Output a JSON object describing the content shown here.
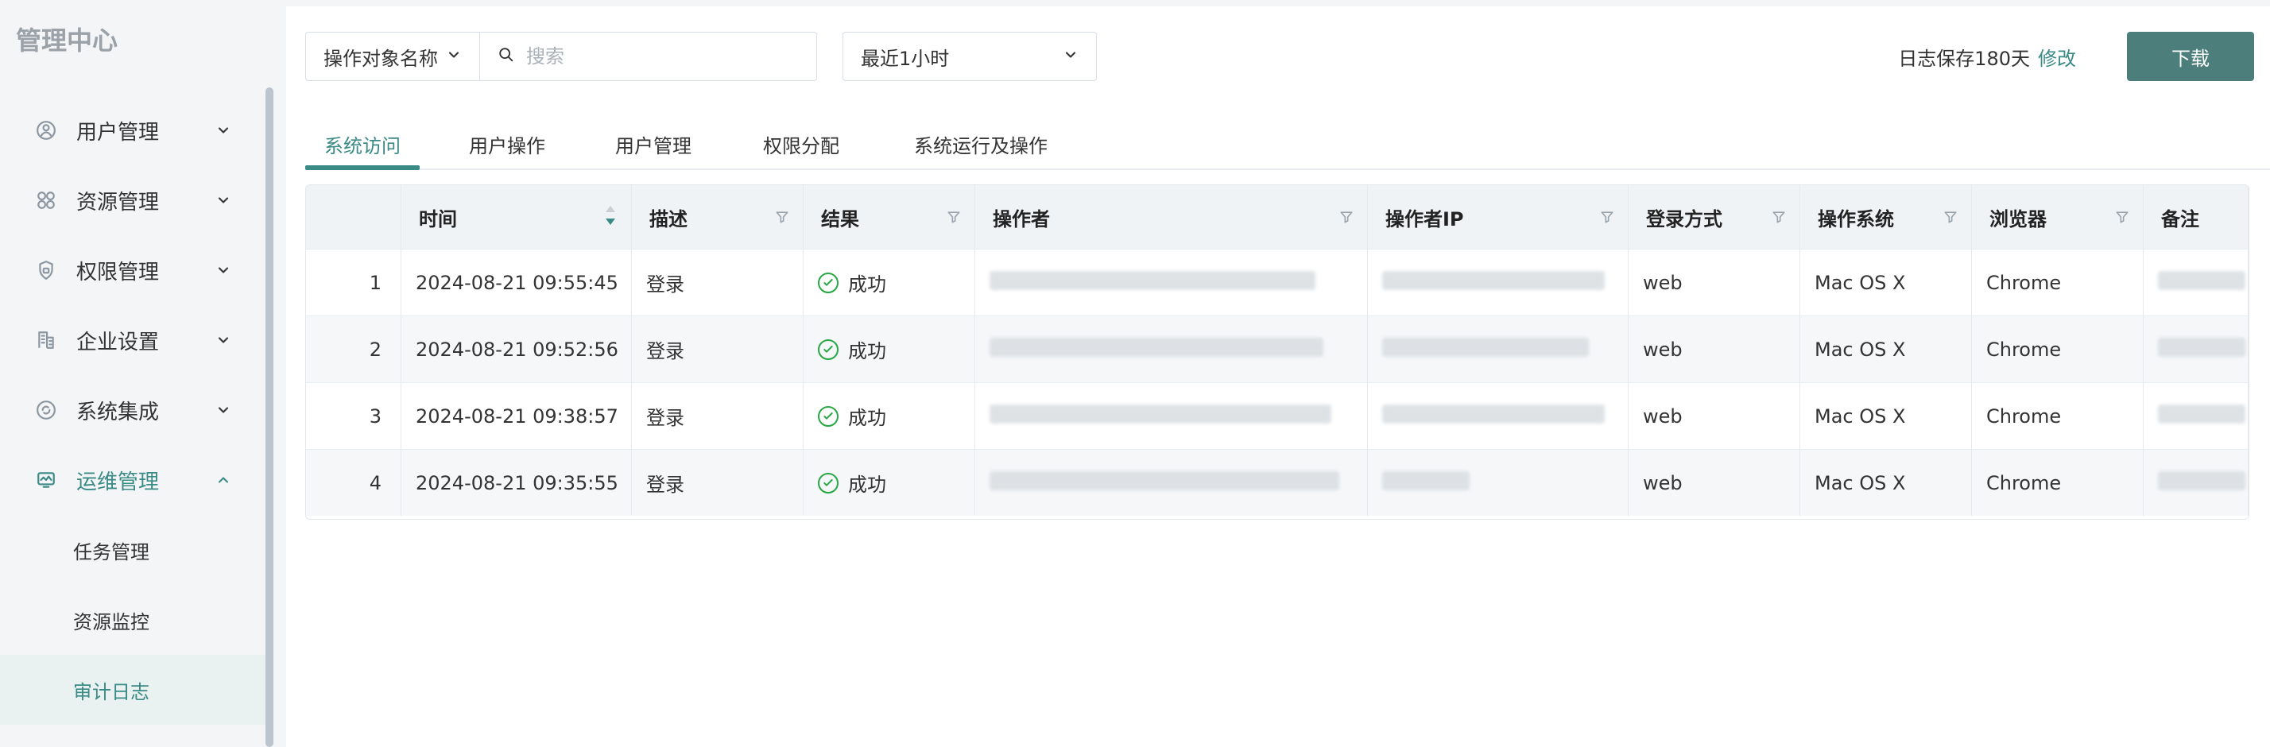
{
  "app": {
    "title": "管理中心"
  },
  "colors": {
    "accent": "#3a8a86",
    "button": "#4c7f7b",
    "success": "#28a745"
  },
  "sidebar": {
    "items": [
      {
        "label": "用户管理",
        "icon": "user-icon",
        "expanded": false
      },
      {
        "label": "资源管理",
        "icon": "grid-icon",
        "expanded": false
      },
      {
        "label": "权限管理",
        "icon": "shield-icon",
        "expanded": false
      },
      {
        "label": "企业设置",
        "icon": "building-icon",
        "expanded": false
      },
      {
        "label": "系统集成",
        "icon": "integration-icon",
        "expanded": false
      },
      {
        "label": "运维管理",
        "icon": "monitor-icon",
        "expanded": true,
        "active": true
      }
    ],
    "submenu": [
      "任务管理",
      "资源监控",
      "审计日志"
    ],
    "selected_submenu": "审计日志"
  },
  "toolbar": {
    "target_label": "操作对象名称",
    "search_placeholder": "搜索",
    "time_range": "最近1小时",
    "retention_text": "日志保存180天",
    "retention_link": "修改",
    "download_label": "下载"
  },
  "tabs": [
    "系统访问",
    "用户操作",
    "用户管理",
    "权限分配",
    "系统运行及操作"
  ],
  "active_tab": "系统访问",
  "table": {
    "headers": [
      "时间",
      "描述",
      "结果",
      "操作者",
      "操作者IP",
      "登录方式",
      "操作系统",
      "浏览器",
      "备注"
    ],
    "rows": [
      {
        "index": "1",
        "time": "2024-08-21 09:55:45",
        "desc": "登录",
        "result": "成功",
        "login": "web",
        "os": "Mac OS X",
        "browser": "Chrome"
      },
      {
        "index": "2",
        "time": "2024-08-21 09:52:56",
        "desc": "登录",
        "result": "成功",
        "login": "web",
        "os": "Mac OS X",
        "browser": "Chrome"
      },
      {
        "index": "3",
        "time": "2024-08-21 09:38:57",
        "desc": "登录",
        "result": "成功",
        "login": "web",
        "os": "Mac OS X",
        "browser": "Chrome"
      },
      {
        "index": "4",
        "time": "2024-08-21 09:35:55",
        "desc": "登录",
        "result": "成功",
        "login": "web",
        "os": "Mac OS X",
        "browser": "Chrome"
      }
    ]
  }
}
